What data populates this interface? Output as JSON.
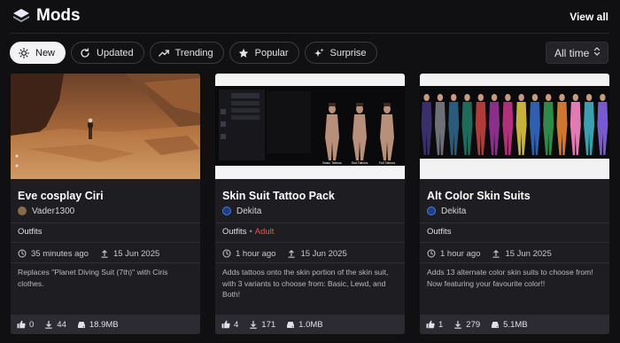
{
  "header": {
    "title": "Mods",
    "view_all": "View all"
  },
  "filters": [
    {
      "label": "New",
      "icon": "sun-icon",
      "active": true
    },
    {
      "label": "Updated",
      "icon": "refresh-icon"
    },
    {
      "label": "Trending",
      "icon": "trending-icon"
    },
    {
      "label": "Popular",
      "icon": "star-icon"
    },
    {
      "label": "Surprise",
      "icon": "sparkles-icon"
    }
  ],
  "time_filter": {
    "value": "All time"
  },
  "mods": [
    {
      "name": "Eve cosplay Ciri",
      "author": "Vader1300",
      "category": "Outfits",
      "uploaded": "35 minutes ago",
      "date": "15 Jun 2025",
      "description": "Replaces \"Planet Diving Suit (7th)\" with Ciris clothes.",
      "endorsements": "0",
      "downloads": "44",
      "size": "18.9MB"
    },
    {
      "name": "Skin Suit Tattoo Pack",
      "author": "Dekita",
      "category": "Outfits",
      "tag": "Adult",
      "uploaded": "1 hour ago",
      "date": "15 Jun 2025",
      "description": "Adds tattoos onto the skin portion of the skin suit, with 3 variants to choose from: Basic, Lewd, and Both!",
      "endorsements": "4",
      "downloads": "171",
      "size": "1.0MB",
      "thumb_captions": [
        "Basic Tattoos",
        "Slut Tattoos",
        "Full Tattoos"
      ]
    },
    {
      "name": "Alt Color Skin Suits",
      "author": "Dekita",
      "category": "Outfits",
      "uploaded": "1 hour ago",
      "date": "15 Jun 2025",
      "description": "Adds 13 alternate color skin suits to choose from! Now featuring your favourite color!!",
      "endorsements": "1",
      "downloads": "279",
      "size": "5.1MB"
    }
  ],
  "colors": {
    "background": "#101012",
    "card": "#1e1e22",
    "adult_tag": "#ef5350",
    "active_chip": "#f2f2f4"
  }
}
